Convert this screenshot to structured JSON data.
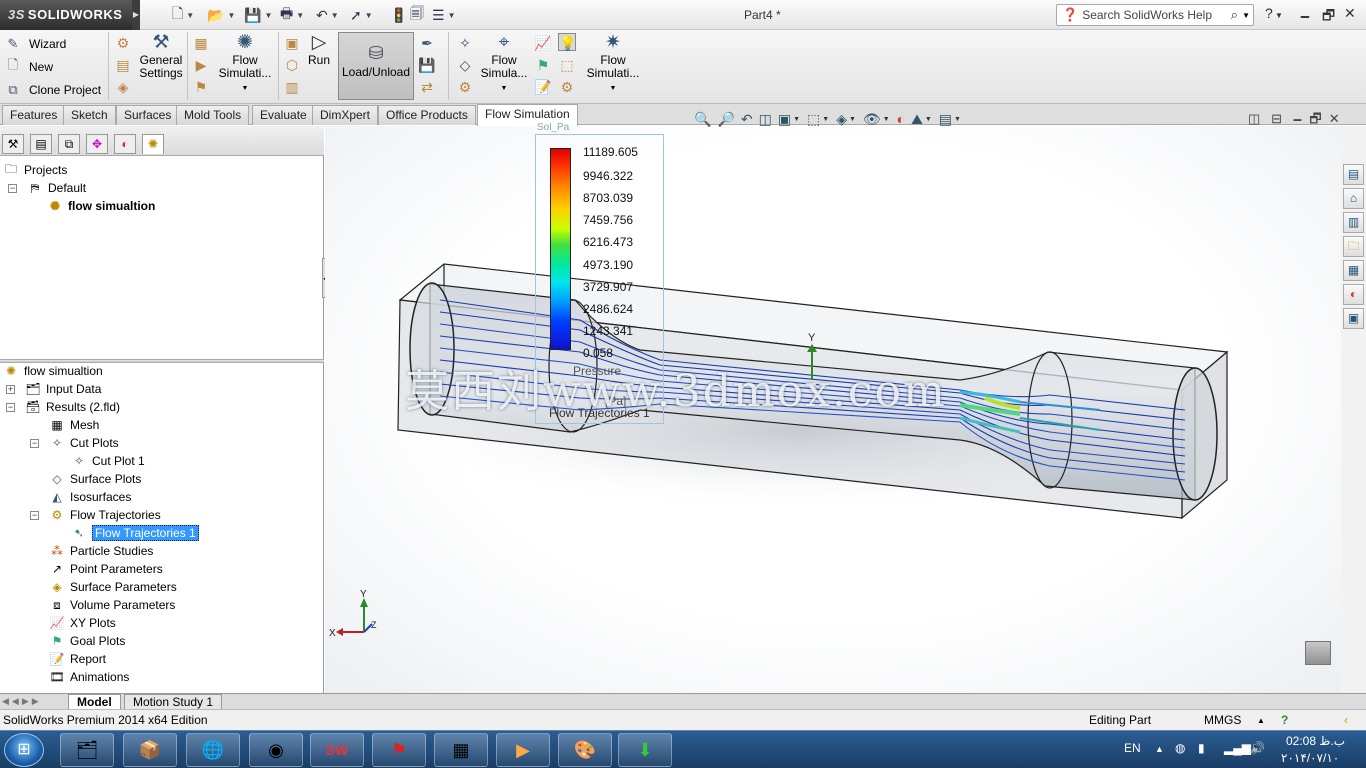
{
  "app": {
    "brand": "SOLIDWORKS",
    "brand_prefix": "3S",
    "doc_title": "Part4 *"
  },
  "search": {
    "placeholder": "Search SolidWorks Help"
  },
  "cmd": {
    "wizard": "Wizard",
    "new": "New",
    "clone": "Clone Project",
    "general_settings_1": "General",
    "general_settings_2": "Settings",
    "flow1_1": "Flow",
    "flow1_2": "Simulati...",
    "run": "Run",
    "load_unload": "Load/Unload",
    "flow2_1": "Flow",
    "flow2_2": "Simula...",
    "flow3_1": "Flow",
    "flow3_2": "Simulati..."
  },
  "tabs": [
    "Features",
    "Sketch",
    "Surfaces",
    "Mold Tools",
    "Evaluate",
    "DimXpert",
    "Office Products",
    "Flow Simulation"
  ],
  "active_tab": "Flow Simulation",
  "projects": {
    "root": "Projects",
    "config": "Default",
    "project": "flow simualtion"
  },
  "tree": {
    "root": "flow simualtion",
    "items": [
      {
        "label": "Input Data"
      },
      {
        "label": "Results (2.fld)"
      },
      {
        "label": "Mesh"
      },
      {
        "label": "Cut Plots"
      },
      {
        "label": "Cut Plot 1"
      },
      {
        "label": "Surface Plots"
      },
      {
        "label": "Isosurfaces"
      },
      {
        "label": "Flow Trajectories"
      },
      {
        "label": "Flow Trajectories 1"
      },
      {
        "label": "Particle Studies"
      },
      {
        "label": "Point Parameters"
      },
      {
        "label": "Surface Parameters"
      },
      {
        "label": "Volume Parameters"
      },
      {
        "label": "XY Plots"
      },
      {
        "label": "Goal Plots"
      },
      {
        "label": "Report"
      },
      {
        "label": "Animations"
      }
    ]
  },
  "legend": {
    "values": [
      "11189.605",
      "9946.322",
      "8703.039",
      "7459.756",
      "6216.473",
      "4973.190",
      "3729.907",
      "2486.624",
      "1243.341",
      "0.058"
    ],
    "header_partial": "Pressure",
    "caption_unit": "[Pa]",
    "caption_title": "Flow Trajectories 1",
    "top_partial": "Sol_Pa"
  },
  "watermark": "莫西刘www.3dmox.com",
  "axes": {
    "y": "Y",
    "x": "X",
    "z": "Z"
  },
  "bottom_tabs": [
    "Model",
    "Motion Study 1"
  ],
  "status": {
    "edition": "SolidWorks Premium 2014 x64 Edition",
    "mode": "Editing Part",
    "units": "MMGS"
  },
  "taskbar": {
    "lang": "EN",
    "time": "02:08 ب.ظ",
    "date": "۲۰۱۴/۰۷/۱۰"
  },
  "colors": {
    "accent": "#3399ff",
    "legend_top": "#e00000",
    "legend_bottom": "#1010d0",
    "taskbar": "#1f4a7a"
  }
}
